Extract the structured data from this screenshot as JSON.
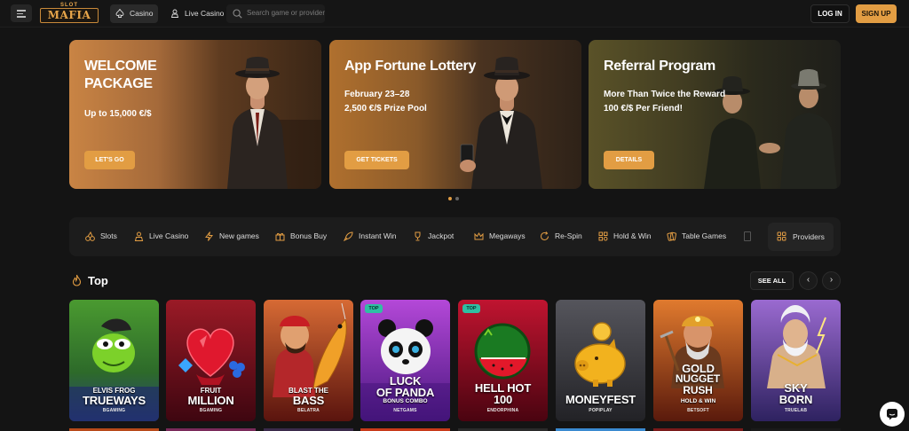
{
  "header": {
    "logo_top": "SLOT",
    "logo_main": "MAFIA",
    "nav": [
      {
        "label": "Casino",
        "active": true
      },
      {
        "label": "Live Casino",
        "active": false
      }
    ],
    "search_placeholder": "Search game or provider",
    "login_label": "LOG IN",
    "signup_label": "SIGN UP"
  },
  "banners": [
    {
      "title": "WELCOME PACKAGE",
      "subtitle": "Up to 15,000 €/$",
      "button": "LET'S GO"
    },
    {
      "title": "App Fortune Lottery",
      "subtitle_lines": [
        "February 23–28",
        "2,500 €/$ Prize Pool"
      ],
      "button": "GET TICKETS"
    },
    {
      "title": "Referral Program",
      "subtitle_lines": [
        "More Than Twice the Reward",
        "100 €/$ Per Friend!"
      ],
      "button": "DETAILS"
    }
  ],
  "carousel": {
    "pages": 2,
    "active": 1
  },
  "categories": [
    {
      "label": "Slots",
      "icon": "cherries-icon"
    },
    {
      "label": "Live Casino",
      "icon": "dealer-icon"
    },
    {
      "label": "New games",
      "icon": "lightning-icon"
    },
    {
      "label": "Bonus Buy",
      "icon": "gift-icon"
    },
    {
      "label": "Instant Win",
      "icon": "rocket-icon"
    },
    {
      "label": "Jackpot",
      "icon": "trophy-icon"
    },
    {
      "label": "Megaways",
      "icon": "crown-icon"
    },
    {
      "label": "Re-Spin",
      "icon": "respin-icon"
    },
    {
      "label": "Hold & Win",
      "icon": "grid-icon"
    },
    {
      "label": "Table Games",
      "icon": "cards-icon"
    }
  ],
  "providers_label": "Providers",
  "top_section": {
    "title": "Top",
    "see_all": "SEE ALL",
    "games": [
      {
        "small": "ELVIS FROG",
        "big": "TRUEWAYS",
        "provider": "BGAMING",
        "badge": "",
        "colors": [
          "#3f8a2c",
          "#2a4a7a"
        ]
      },
      {
        "small": "FRUIT",
        "big": "MILLION",
        "provider": "BGAMING",
        "badge": "",
        "colors": [
          "#8a1420",
          "#4a0a14"
        ]
      },
      {
        "small": "BLAST THE",
        "big": "BASS",
        "provider": "BELATRA",
        "badge": "",
        "colors": [
          "#c8552a",
          "#6a1a10"
        ]
      },
      {
        "small": "LUCK",
        "big": "OF PANDA",
        "sub": "BONUS COMBO",
        "provider": "NETGAMS",
        "badge": "TOP",
        "colors": [
          "#a23cc8",
          "#5a1e8a"
        ]
      },
      {
        "small": "",
        "big": "HELL HOT",
        "big2": "100",
        "provider": "ENDORPHINA",
        "badge": "TOP",
        "colors": [
          "#a8102a",
          "#5a0614"
        ]
      },
      {
        "small": "",
        "big": "MONEYFEST",
        "provider": "POPIPLAY",
        "badge": "",
        "colors": [
          "#4a4a52",
          "#2a2a30"
        ]
      },
      {
        "small": "GOLD",
        "big": "NUGGET RUSH",
        "sub": "HOLD & WIN",
        "provider": "BETSOFT",
        "badge": "",
        "colors": [
          "#c8702a",
          "#6a2a12"
        ]
      },
      {
        "small": "",
        "big": "SKY",
        "big2": "BORN",
        "provider": "TRUELAB",
        "badge": "",
        "colors": [
          "#8a5ac8",
          "#3a2a6a"
        ]
      }
    ]
  },
  "colors": {
    "accent": "#e29d43",
    "background": "#141414",
    "badge": "#2fbfa3"
  }
}
